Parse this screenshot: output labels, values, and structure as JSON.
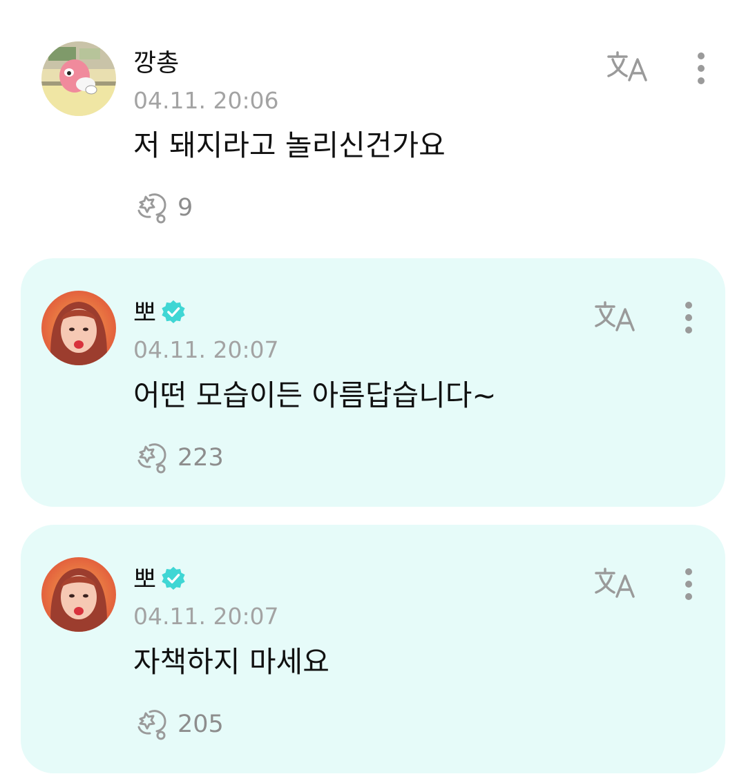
{
  "comments": [
    {
      "author": "깡총",
      "verified": false,
      "date": "04.11. 20:06",
      "text": "저 돼지라고 놀리신건가요",
      "likes": "9",
      "highlighted": false
    },
    {
      "author": "뽀",
      "verified": true,
      "date": "04.11. 20:07",
      "text": "어떤 모습이든 아름답습니다~",
      "likes": "223",
      "highlighted": true
    },
    {
      "author": "뽀",
      "verified": true,
      "date": "04.11. 20:07",
      "text": "자책하지 마세요",
      "likes": "205",
      "highlighted": true
    }
  ],
  "icons": {
    "like": "like-icon",
    "translate": "translate-icon",
    "more": "more-options-icon",
    "verified": "verified-badge-icon"
  },
  "colors": {
    "highlight_bg": "#e6fbf9",
    "verified": "#3fd6d4",
    "meta_text": "#a3a3a3",
    "icon": "#9a9a9a"
  }
}
